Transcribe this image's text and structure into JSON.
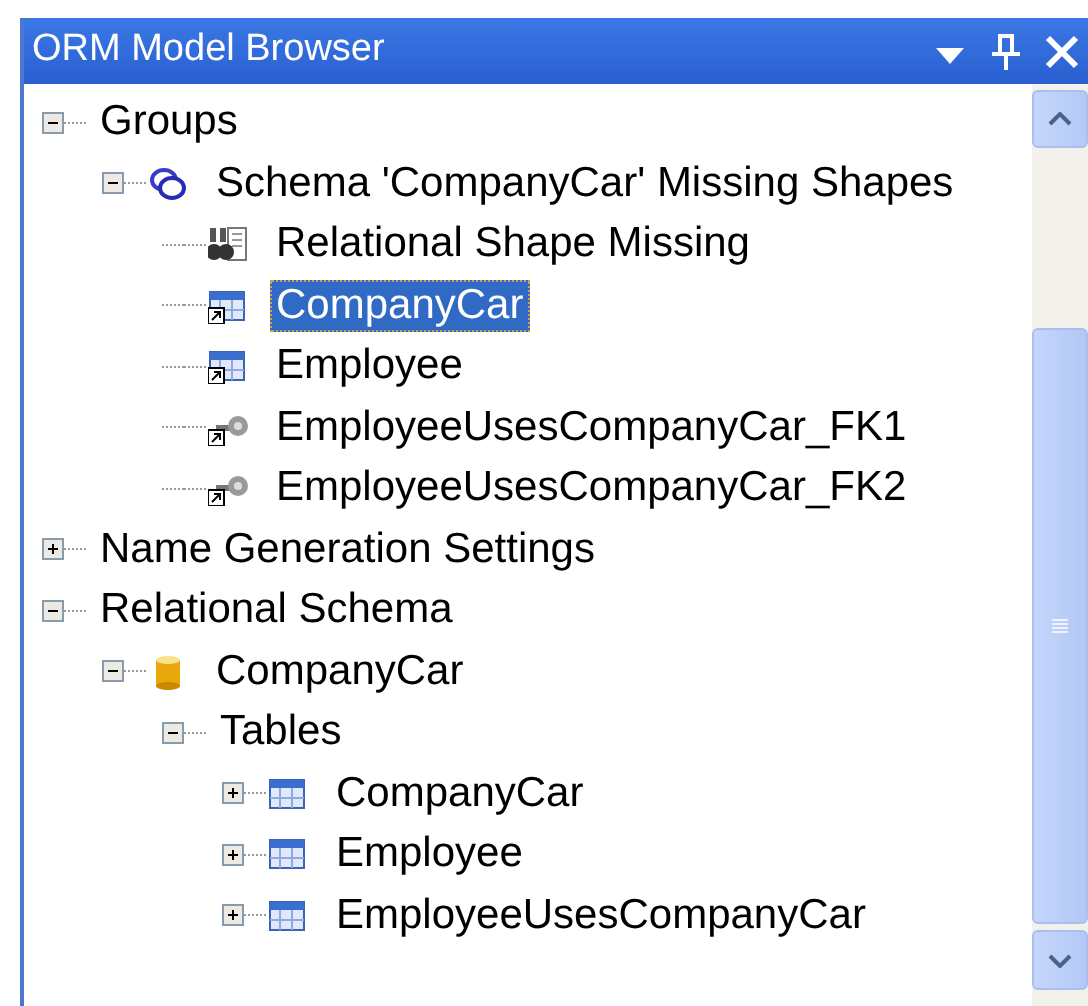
{
  "window": {
    "title": "ORM Model Browser"
  },
  "tree": [
    {
      "label": "Groups",
      "expanded": true,
      "selected": false,
      "children": [
        {
          "label": "Schema 'CompanyCar' Missing Shapes",
          "kind": "group",
          "expanded": true,
          "selected": false,
          "children": [
            {
              "label": "Relational Shape Missing",
              "kind": "missing",
              "selected": false
            },
            {
              "label": "CompanyCar",
              "kind": "table-shortcut",
              "selected": true
            },
            {
              "label": "Employee",
              "kind": "table-shortcut",
              "selected": false
            },
            {
              "label": "EmployeeUsesCompanyCar_FK1",
              "kind": "key-shortcut",
              "selected": false
            },
            {
              "label": "EmployeeUsesCompanyCar_FK2",
              "kind": "key-shortcut",
              "selected": false
            }
          ]
        }
      ]
    },
    {
      "label": "Name Generation Settings",
      "expanded": false,
      "selected": false
    },
    {
      "label": "Relational Schema",
      "expanded": true,
      "selected": false,
      "children": [
        {
          "label": "CompanyCar",
          "kind": "database",
          "expanded": true,
          "selected": false,
          "children": [
            {
              "label": "Tables",
              "expanded": true,
              "selected": false,
              "children": [
                {
                  "label": "CompanyCar",
                  "kind": "table",
                  "expanded": false,
                  "selected": false
                },
                {
                  "label": "Employee",
                  "kind": "table",
                  "expanded": false,
                  "selected": false
                },
                {
                  "label": "EmployeeUsesCompanyCar",
                  "kind": "table",
                  "expanded": false,
                  "selected": false
                }
              ]
            }
          ]
        }
      ]
    }
  ]
}
